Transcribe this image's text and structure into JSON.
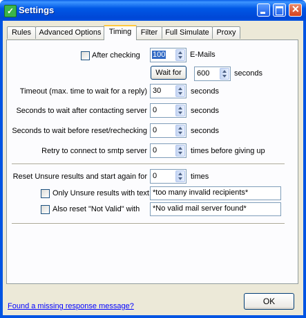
{
  "window": {
    "title": "Settings"
  },
  "tabs": [
    "Rules",
    "Advanced Options",
    "Timing",
    "Filter",
    "Full Simulate",
    "Proxy"
  ],
  "active_tab": "Timing",
  "timing": {
    "after_checking_label": "After checking",
    "after_checking_checked": false,
    "emails_value": "100",
    "emails_unit": "E-Mails",
    "wait_for_button": "Wait for",
    "wait_value": "600",
    "wait_unit": "seconds",
    "timeout_label": "Timeout (max. time to wait for a reply)",
    "timeout_value": "30",
    "timeout_unit": "seconds",
    "after_contact_label": "Seconds to wait after contacting server",
    "after_contact_value": "0",
    "after_contact_unit": "seconds",
    "before_reset_label": "Seconds to wait before reset/rechecking",
    "before_reset_value": "0",
    "before_reset_unit": "seconds",
    "retry_label": "Retry to connect to smtp server",
    "retry_value": "0",
    "retry_unit": "times before giving up",
    "reset_unsure_label": "Reset Unsure results and start again for",
    "reset_unsure_value": "0",
    "reset_unsure_unit": "times",
    "only_unsure_label": "Only Unsure results with text",
    "only_unsure_checked": false,
    "only_unsure_text": "*too many invalid recipients*",
    "also_reset_label": "Also reset \"Not Valid\" with",
    "also_reset_checked": false,
    "also_reset_text": "*No valid mail server found*"
  },
  "footer": {
    "link": "Found a missing response message?",
    "ok_button": "OK"
  }
}
